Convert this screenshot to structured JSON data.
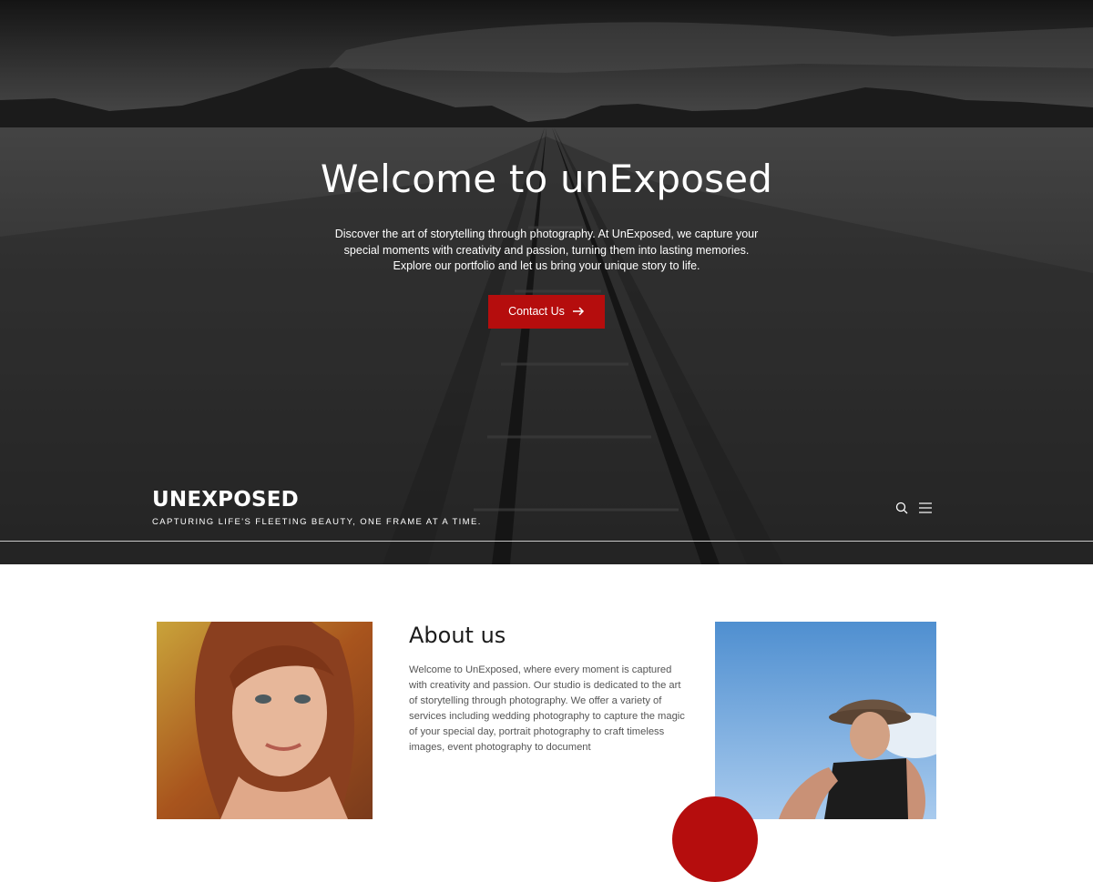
{
  "hero": {
    "title": "Welcome to unExposed",
    "description": "Discover the art of storytelling through photography. At UnExposed, we capture your special moments with creativity and passion, turning them into lasting memories. Explore our portfolio and let us bring your unique story to life.",
    "cta_label": "Contact Us",
    "cta_icon": "arrow-right-icon"
  },
  "header": {
    "site_name": "UNEXPOSED",
    "tagline": "CAPTURING LIFE'S FLEETING BEAUTY, ONE FRAME AT A TIME.",
    "icons": [
      "search-icon",
      "menu-icon"
    ]
  },
  "about": {
    "title": "About us",
    "body": "Welcome to UnExposed, where every moment is captured with creativity and passion. Our studio is dedicated to the art of storytelling through photography. We offer a variety of services including wedding photography to capture the magic of your special day, portrait photography to craft timeless images, event photography to document"
  },
  "colors": {
    "accent": "#b50d0d",
    "hero_text": "#ffffff",
    "body_text": "#555555"
  }
}
